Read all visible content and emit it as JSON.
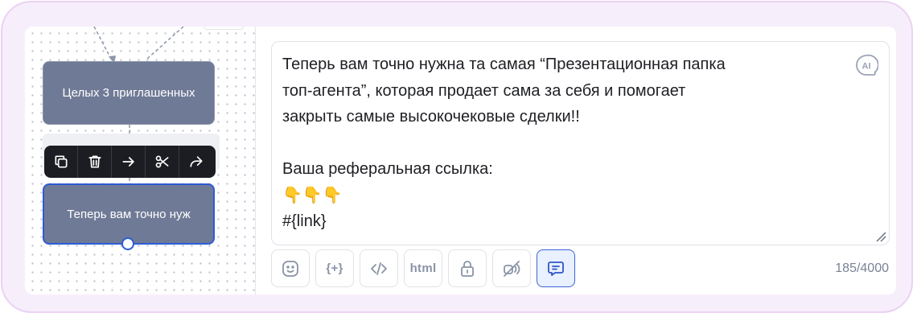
{
  "flow": {
    "node1_label": "Целых 3 приглашенных",
    "node2_label": "Теперь вам точно нуж",
    "toolbar_icons": [
      "copy-icon",
      "trash-icon",
      "arrow-right-icon",
      "scissors-icon",
      "share-icon"
    ]
  },
  "editor": {
    "message": "Теперь вам точно нужна та самая “Презентационная папка\nтоп-агента”, которая продает сама за себя и помогает\nзакрыть самые высокочековые сделки!!\n\nВаша реферальная ссылка:\n👇👇👇\n#{link}",
    "ai_label": "AI",
    "char_counter": "185/4000"
  },
  "bottom_toolbar": {
    "buttons": [
      {
        "name": "emoji-button",
        "icon": "smile-icon"
      },
      {
        "name": "variable-button",
        "label": "{+}"
      },
      {
        "name": "code-button",
        "icon": "code-icon"
      },
      {
        "name": "html-button",
        "label": "html"
      },
      {
        "name": "lock-button",
        "icon": "lock-icon"
      },
      {
        "name": "voice-off-button",
        "icon": "voice-off-icon"
      },
      {
        "name": "comment-button",
        "icon": "comment-icon",
        "active": true
      }
    ]
  },
  "colors": {
    "accent": "#2c5bd6",
    "node_fill": "#6f7a96",
    "frame_border": "#ead2f3",
    "toolbar_bg": "#1c1d22"
  }
}
